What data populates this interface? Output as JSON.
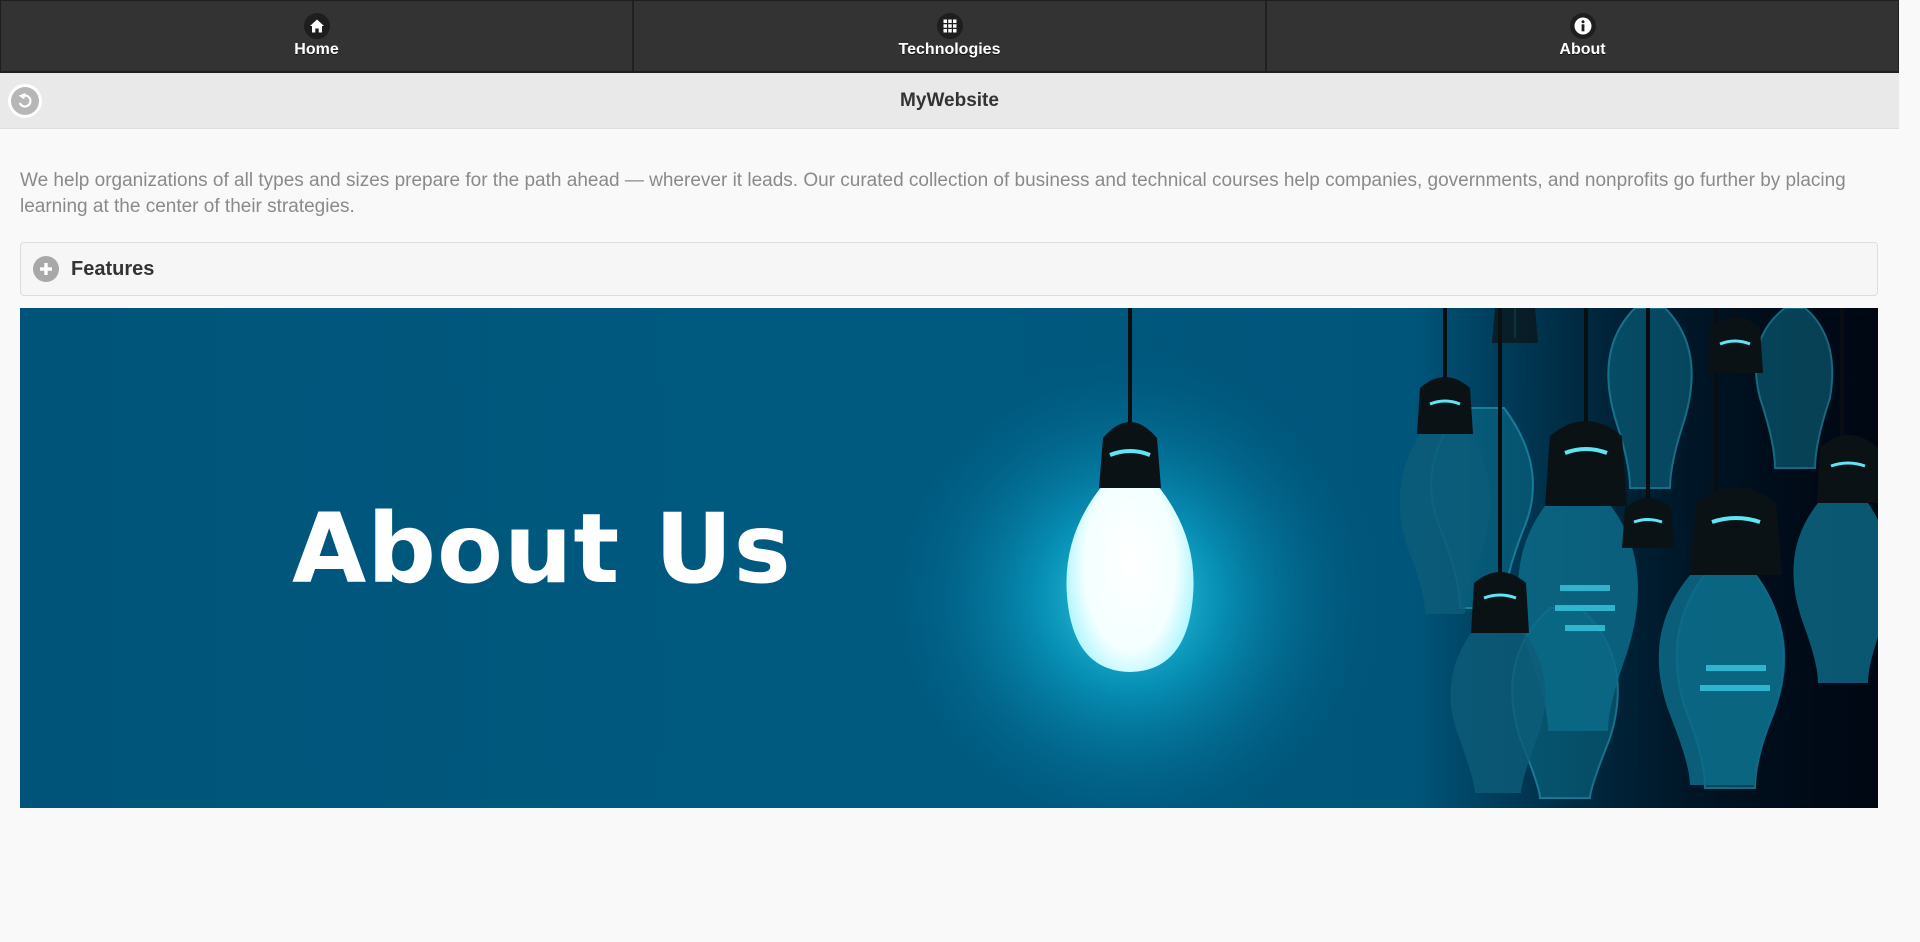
{
  "nav": {
    "items": [
      {
        "label": "Home",
        "icon": "home-icon"
      },
      {
        "label": "Technologies",
        "icon": "grid-icon"
      },
      {
        "label": "About",
        "icon": "info-icon"
      }
    ]
  },
  "header": {
    "title": "MyWebsite",
    "back_icon": "back-icon"
  },
  "main": {
    "intro": "We help organizations of all types and sizes prepare for the path ahead — wherever it leads. Our curated collection of business and technical courses help companies, governments, and nonprofits go further by placing learning at the center of their strategies.",
    "collapsible": {
      "label": "Features",
      "icon": "plus-icon"
    },
    "banner": {
      "text": "About Us",
      "colors": {
        "background": "#005479",
        "glow": "#1fc8e0",
        "dark": "#000814"
      }
    }
  }
}
